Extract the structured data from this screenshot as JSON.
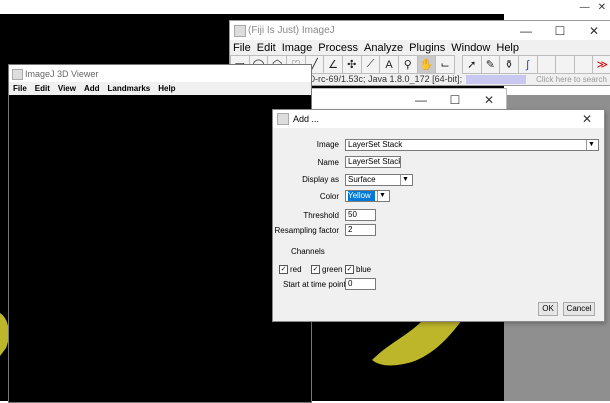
{
  "imagej": {
    "title": "(Fiji Is Just) ImageJ",
    "menu": [
      "File",
      "Edit",
      "Image",
      "Process",
      "Analyze",
      "Plugins",
      "Window",
      "Help"
    ],
    "status_text": "0-rc-69/1.53c; Java 1.8.0_172 [64-bit];",
    "search_placeholder": "Click here to search",
    "tool_icons": [
      "rectangle-icon",
      "oval-icon",
      "polygon-icon",
      "freehand-icon",
      "line-icon",
      "angle-icon",
      "multipoint-icon",
      "wand-icon",
      "text-icon",
      "magnifier-icon",
      "hand-icon",
      "dropper-icon",
      "arrow-icon",
      "brush-icon",
      "pencil-icon",
      "flood-fill-icon",
      "more-tools-icon"
    ]
  },
  "viewer": {
    "title": "ImageJ 3D Viewer",
    "menu": [
      "File",
      "Edit",
      "View",
      "Add",
      "Landmarks",
      "Help"
    ]
  },
  "dialog": {
    "title": "Add ...",
    "image_label": "Image",
    "image_value": "LayerSet Stack",
    "name_label": "Name",
    "name_value": "LayerSet Stack",
    "display_label": "Display as",
    "display_value": "Surface",
    "color_label": "Color",
    "color_value": "Yellow",
    "threshold_label": "Threshold",
    "threshold_value": "50",
    "resampling_label": "Resampling factor",
    "resampling_value": "2",
    "channels_label": "Channels",
    "channel_red": "red",
    "channel_green": "green",
    "channel_blue": "blue",
    "timepoint_label": "Start at time point",
    "timepoint_value": "0",
    "ok": "OK",
    "cancel": "Cancel"
  },
  "colors": {
    "blob": "#bdb52a",
    "selection": "#0078d7",
    "close_red": "#e81123"
  }
}
